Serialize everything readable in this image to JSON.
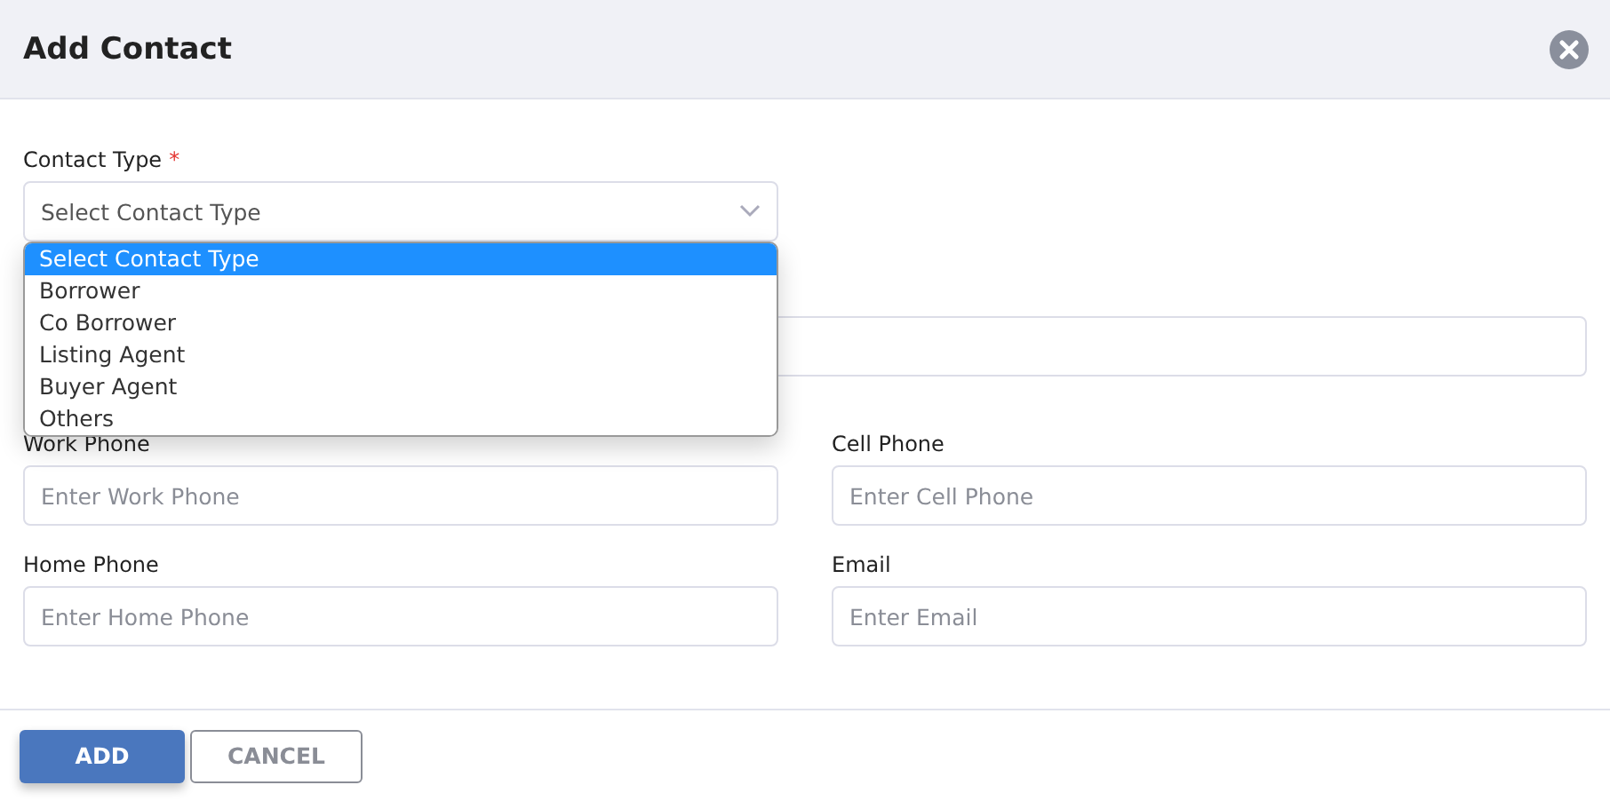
{
  "dialog": {
    "title": "Add Contact"
  },
  "contact_type": {
    "label": "Contact Type",
    "required_mark": "*",
    "value": "Select Contact Type",
    "expanded": true,
    "options": [
      {
        "label": "Select Contact Type",
        "selected": true
      },
      {
        "label": "Borrower",
        "selected": false
      },
      {
        "label": "Co Borrower",
        "selected": false
      },
      {
        "label": "Listing Agent",
        "selected": false
      },
      {
        "label": "Buyer Agent",
        "selected": false
      },
      {
        "label": "Others",
        "selected": false
      }
    ]
  },
  "fields": [
    {
      "label": "Work Phone",
      "placeholder": "Enter Work Phone"
    },
    {
      "label": "Cell Phone",
      "placeholder": "Enter Cell Phone"
    },
    {
      "label": "Home Phone",
      "placeholder": "Enter Home Phone"
    },
    {
      "label": "Email",
      "placeholder": "Enter Email"
    }
  ],
  "buttons": [
    {
      "label": "ADD",
      "kind": "primary"
    },
    {
      "label": "CANCEL",
      "kind": "secondary"
    }
  ]
}
